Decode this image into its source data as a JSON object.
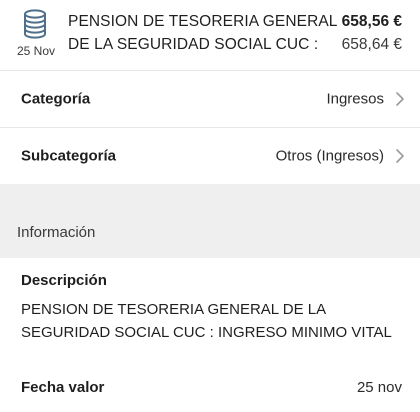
{
  "transaction": {
    "icon": "coins-stack-icon",
    "date": "25 Nov",
    "name": "PENSION DE TESORERIA GENERAL DE LA SEGURIDAD SOCIAL CUC :",
    "amount": "658,56 €",
    "balance": "658,64 €"
  },
  "rows": {
    "category": {
      "label": "Categoría",
      "value": "Ingresos",
      "icon": "chevron-right-icon"
    },
    "subcategory": {
      "label": "Subcategoría",
      "value": "Otros (Ingresos)",
      "icon": "chevron-right-icon"
    }
  },
  "info_section": {
    "title": "Información",
    "description_label": "Descripción",
    "description_text": "PENSION DE TESORERIA GENERAL DE LA SEGURIDAD SOCIAL CUC : INGRESO MINIMO VITAL",
    "value_date_label": "Fecha valor",
    "value_date": "25 nov"
  },
  "colors": {
    "icon_blue": "#4f6f8a",
    "section_background": "#efefef",
    "divider": "#e6e6e6",
    "chevron": "#9a9a9a"
  }
}
